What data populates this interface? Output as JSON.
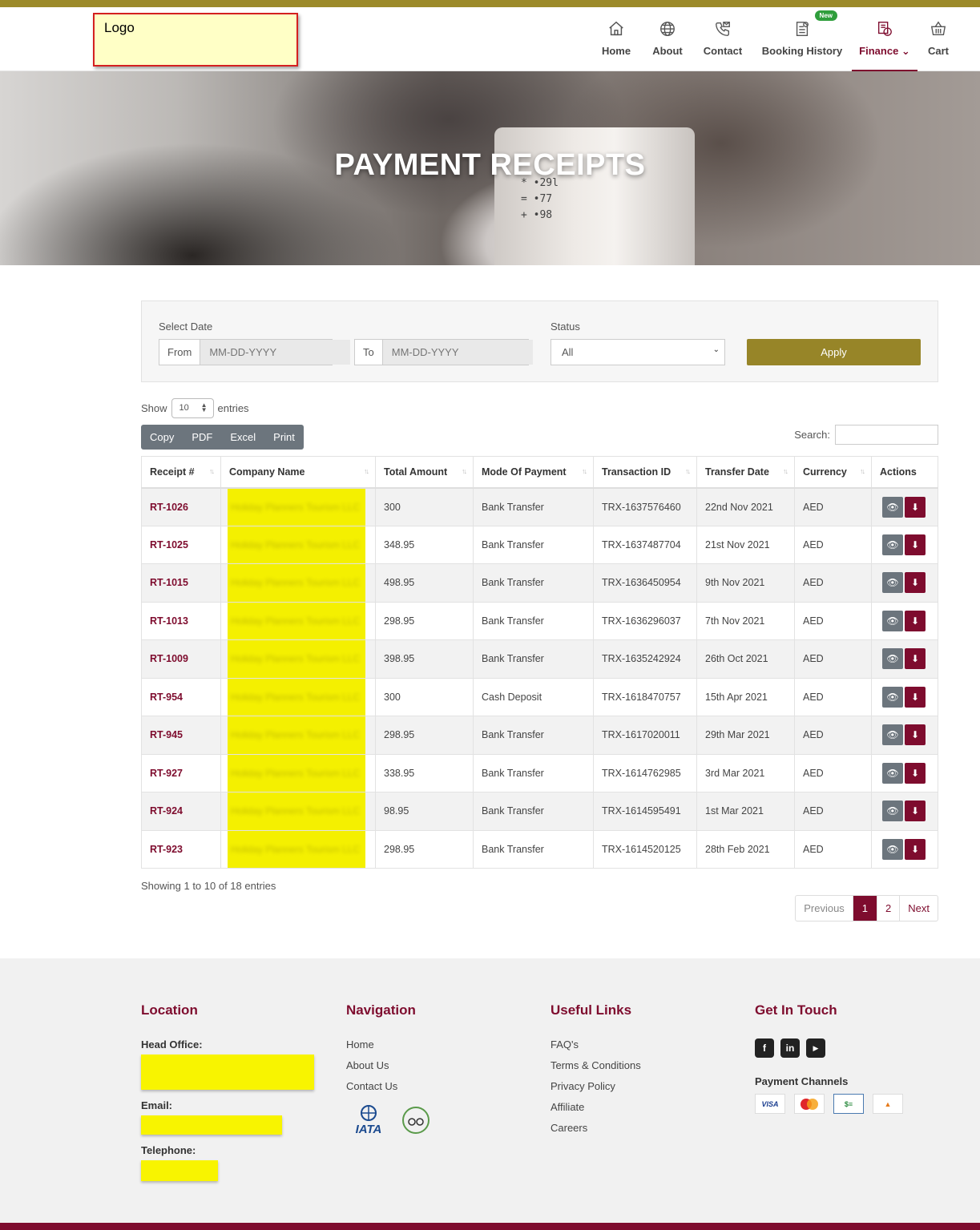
{
  "logo": {
    "text": "Logo"
  },
  "nav": {
    "items": [
      {
        "label": "Home",
        "icon": "home-icon"
      },
      {
        "label": "About",
        "icon": "globe-icon"
      },
      {
        "label": "Contact",
        "icon": "phone-icon"
      },
      {
        "label": "Booking History",
        "icon": "document-icon",
        "badge": "New"
      },
      {
        "label": "Finance",
        "icon": "finance-icon",
        "active": true
      },
      {
        "label": "Cart",
        "icon": "cart-icon"
      }
    ]
  },
  "hero": {
    "title": "PAYMENT RECEIPTS"
  },
  "filters": {
    "select_date_label": "Select Date",
    "from_label": "From",
    "from_placeholder": "MM-DD-YYYY",
    "to_label": "To",
    "to_placeholder": "MM-DD-YYYY",
    "status_label": "Status",
    "status_value": "All",
    "apply_label": "Apply"
  },
  "table_controls": {
    "show_label": "Show",
    "entries_value": "10",
    "entries_label": "entries",
    "export_buttons": [
      "Copy",
      "PDF",
      "Excel",
      "Print"
    ],
    "search_label": "Search:"
  },
  "table": {
    "columns": [
      "Receipt #",
      "Company Name",
      "Total Amount",
      "Mode Of Payment",
      "Transaction ID",
      "Transfer Date",
      "Currency",
      "Actions"
    ],
    "rows": [
      {
        "receipt": "RT-1026",
        "company": "Holiday Planners Tourism LLC",
        "amount": "300",
        "mode": "Bank Transfer",
        "txn": "TRX-1637576460",
        "date": "22nd Nov 2021",
        "currency": "AED"
      },
      {
        "receipt": "RT-1025",
        "company": "Holiday Planners Tourism LLC",
        "amount": "348.95",
        "mode": "Bank Transfer",
        "txn": "TRX-1637487704",
        "date": "21st Nov 2021",
        "currency": "AED"
      },
      {
        "receipt": "RT-1015",
        "company": "Holiday Planners Tourism LLC",
        "amount": "498.95",
        "mode": "Bank Transfer",
        "txn": "TRX-1636450954",
        "date": "9th Nov 2021",
        "currency": "AED"
      },
      {
        "receipt": "RT-1013",
        "company": "Holiday Planners Tourism LLC",
        "amount": "298.95",
        "mode": "Bank Transfer",
        "txn": "TRX-1636296037",
        "date": "7th Nov 2021",
        "currency": "AED"
      },
      {
        "receipt": "RT-1009",
        "company": "Holiday Planners Tourism LLC",
        "amount": "398.95",
        "mode": "Bank Transfer",
        "txn": "TRX-1635242924",
        "date": "26th Oct 2021",
        "currency": "AED"
      },
      {
        "receipt": "RT-954",
        "company": "Holiday Planners Tourism LLC",
        "amount": "300",
        "mode": "Cash Deposit",
        "txn": "TRX-1618470757",
        "date": "15th Apr 2021",
        "currency": "AED"
      },
      {
        "receipt": "RT-945",
        "company": "Holiday Planners Tourism LLC",
        "amount": "298.95",
        "mode": "Bank Transfer",
        "txn": "TRX-1617020011",
        "date": "29th Mar 2021",
        "currency": "AED"
      },
      {
        "receipt": "RT-927",
        "company": "Holiday Planners Tourism LLC",
        "amount": "338.95",
        "mode": "Bank Transfer",
        "txn": "TRX-1614762985",
        "date": "3rd Mar 2021",
        "currency": "AED"
      },
      {
        "receipt": "RT-924",
        "company": "Holiday Planners Tourism LLC",
        "amount": "98.95",
        "mode": "Bank Transfer",
        "txn": "TRX-1614595491",
        "date": "1st Mar 2021",
        "currency": "AED"
      },
      {
        "receipt": "RT-923",
        "company": "Holiday Planners Tourism LLC",
        "amount": "298.95",
        "mode": "Bank Transfer",
        "txn": "TRX-1614520125",
        "date": "28th Feb 2021",
        "currency": "AED"
      }
    ]
  },
  "pagination": {
    "info": "Showing 1 to 10 of 18 entries",
    "previous": "Previous",
    "pages": [
      "1",
      "2"
    ],
    "current": "1",
    "next": "Next"
  },
  "footer": {
    "location": {
      "title": "Location",
      "head_office_label": "Head Office:",
      "email_label": "Email:",
      "telephone_label": "Telephone:"
    },
    "navigation": {
      "title": "Navigation",
      "links": [
        "Home",
        "About Us",
        "Contact Us"
      ]
    },
    "useful_links": {
      "title": "Useful Links",
      "links": [
        "FAQ's",
        "Terms & Conditions",
        "Privacy Policy",
        "Affiliate",
        "Careers"
      ]
    },
    "get_in_touch": {
      "title": "Get In Touch",
      "social": [
        "facebook-icon",
        "linkedin-icon",
        "youtube-icon"
      ],
      "payment_channels_label": "Payment Channels",
      "payment_icons": [
        "VISA",
        "mastercard-icon",
        "cheque-icon",
        "cash-deposit-icon"
      ]
    },
    "accreditation": [
      "IATA",
      "tripadvisor-icon"
    ]
  },
  "colors": {
    "accent_gold": "#978528",
    "brand_maroon": "#7e0c2e",
    "redaction_yellow": "#f4f000"
  }
}
